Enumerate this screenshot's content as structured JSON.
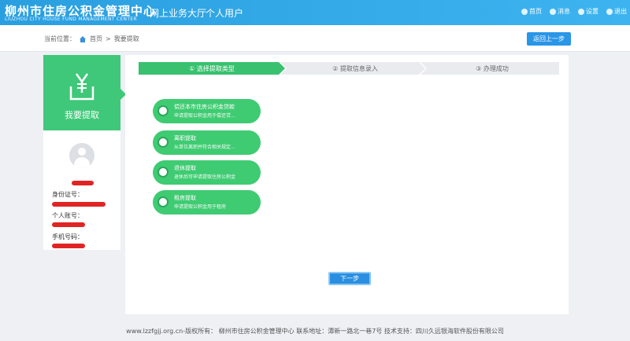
{
  "header": {
    "logo_cn": "柳州市住房公积金管理中心",
    "logo_en": "LIUZHOU CITY HOUSE FUND MANAGEMENT CENTER",
    "system_name": "网上业务大厅",
    "user_type": "个人用户",
    "links": [
      {
        "label": "首页",
        "icon": "home-icon"
      },
      {
        "label": "消息",
        "icon": "message-icon"
      },
      {
        "label": "设置",
        "icon": "gear-icon"
      },
      {
        "label": "退出",
        "icon": "logout-icon"
      }
    ]
  },
  "breadcrumb": {
    "prefix": "当前位置：",
    "home": "首页",
    "separator": ">",
    "current": "我要提取"
  },
  "back_button": "返回上一步",
  "sidebar": {
    "title": "我要提取",
    "icon": "yuan-withdraw-icon",
    "id_label": "身份证号：",
    "account_label": "个人账号：",
    "phone_label": "手机号码："
  },
  "steps": [
    {
      "label": "① 选择提取类型",
      "active": true
    },
    {
      "label": "② 提取信息录入",
      "active": false
    },
    {
      "label": "③ 办理成功",
      "active": false
    }
  ],
  "options": [
    {
      "title": "偿还本市住房公积金贷款",
      "desc": "申请提取公积金用于偿还贷..."
    },
    {
      "title": "离职提取",
      "desc": "从单位离职并符合相关规定..."
    },
    {
      "title": "退休提取",
      "desc": "退休后可申请提取住房公积金"
    },
    {
      "title": "租房提取",
      "desc": "申请提取公积金用于租房"
    }
  ],
  "next_button": "下一步",
  "footer": "www.lzzfgjj.org.cn-版权所有： 柳州市住房公积金管理中心 联系地址：潭新一路北一巷7号 技术支持：四川久远银海软件股份有限公司",
  "colors": {
    "header_blue": "#2a9fe0",
    "accent_green": "#3fc879",
    "button_blue": "#2a96e6",
    "redaction_red": "#e02424"
  }
}
